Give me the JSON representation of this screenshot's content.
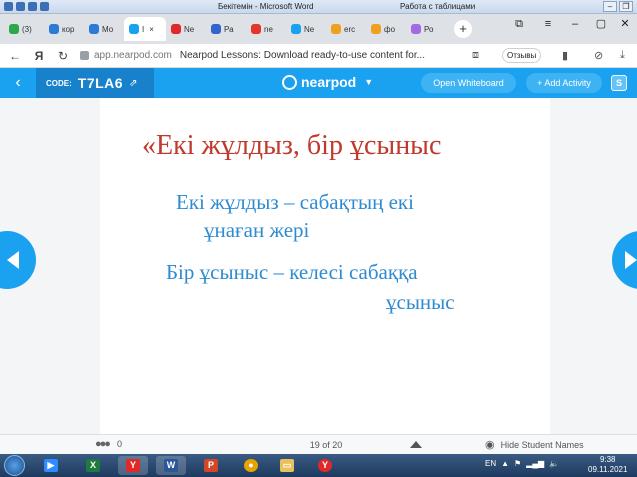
{
  "word_window": {
    "title": "Бекітемін - Microsoft Word",
    "context_title": "Работа с таблицами"
  },
  "browser": {
    "tabs": [
      {
        "label": "(3)",
        "color": "#2ba84a"
      },
      {
        "label": "кор",
        "color": "#2b7bd6"
      },
      {
        "label": "Мо",
        "color": "#2b7bd6"
      },
      {
        "label": "I",
        "color": "#1aa1ef",
        "active": true,
        "close": "×"
      },
      {
        "label": "Ne",
        "color": "#e02a2a"
      },
      {
        "label": "Ра",
        "color": "#3366cc"
      },
      {
        "label": "ne",
        "color": "#e2362a"
      },
      {
        "label": "Ne",
        "color": "#1aa1ef"
      },
      {
        "label": "erc",
        "color": "#f0a020"
      },
      {
        "label": "фо",
        "color": "#f0a020"
      },
      {
        "label": "Ро",
        "color": "#a46ae0"
      }
    ],
    "new_tab": "+",
    "url": "app.nearpod.com",
    "page_title": "Nearpod Lessons: Download ready-to-use content for...",
    "reviews_label": "Отзывы"
  },
  "nearpod": {
    "code_label": "CODE:",
    "code": "T7LA6",
    "logo_text": "nearpod",
    "open_whiteboard": "Open Whiteboard",
    "add_activity": "+ Add Activity",
    "slide": {
      "title": "«Екі жұлдыз, бір ұсыныс",
      "line1": "Екі жұлдыз – сабақтың екі",
      "line2": "ұнаған жері",
      "line3": "Бір ұсыныс – келесі сабаққа",
      "line4": "ұсыныс"
    },
    "footer": {
      "student_count": "0",
      "page": "19 of 20",
      "hide_names": "Hide Student Names"
    }
  },
  "taskbar": {
    "language": "EN",
    "time": "9:38",
    "date": "09.11.2021"
  }
}
